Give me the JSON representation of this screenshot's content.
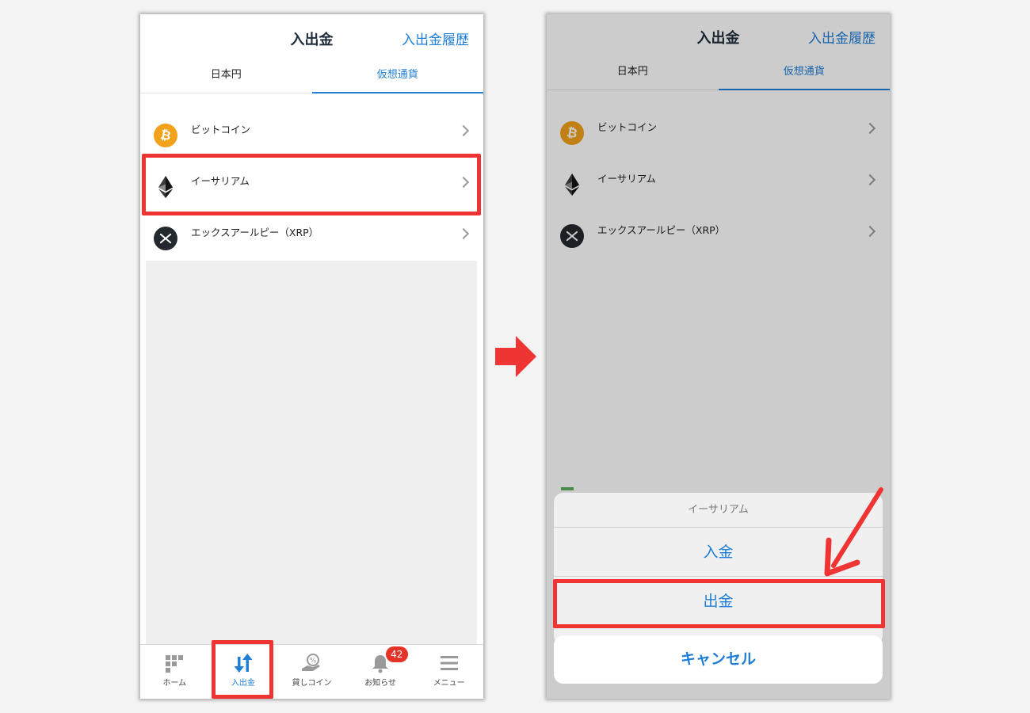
{
  "left_screen": {
    "header": {
      "title": "入出金",
      "history_link": "入出金履歴"
    },
    "tabs": [
      {
        "label": "日本円",
        "active": false
      },
      {
        "label": "仮想通貨",
        "active": true
      }
    ],
    "coins": [
      {
        "name": "ビットコイン",
        "icon": "bitcoin-icon"
      },
      {
        "name": "イーサリアム",
        "icon": "ethereum-icon",
        "highlighted": true
      },
      {
        "name": "エックスアールピー（XRP）",
        "icon": "xrp-icon"
      }
    ],
    "tabbar": [
      {
        "label": "ホーム",
        "icon": "grid-icon"
      },
      {
        "label": "入出金",
        "icon": "transfer-arrows-icon",
        "active": true,
        "highlighted": true
      },
      {
        "label": "貸しコイン",
        "icon": "lending-hand-icon"
      },
      {
        "label": "お知らせ",
        "icon": "bell-icon",
        "badge": "42"
      },
      {
        "label": "メニュー",
        "icon": "menu-icon"
      }
    ]
  },
  "right_screen": {
    "header": {
      "title": "入出金",
      "history_link": "入出金履歴"
    },
    "tabs": [
      {
        "label": "日本円",
        "active": false
      },
      {
        "label": "仮想通貨",
        "active": true
      }
    ],
    "coins": [
      {
        "name": "ビットコイン",
        "icon": "bitcoin-icon"
      },
      {
        "name": "イーサリアム",
        "icon": "ethereum-icon"
      },
      {
        "name": "エックスアールピー（XRP）",
        "icon": "xrp-icon"
      }
    ],
    "action_sheet": {
      "title": "イーサリアム",
      "deposit": "入金",
      "withdraw": "出金",
      "cancel": "キャンセル"
    }
  },
  "colors": {
    "accent_blue": "#1f7ed6",
    "highlight_red": "#ef3434",
    "bitcoin_orange": "#f2a11a",
    "badge_red": "#e6332a"
  }
}
